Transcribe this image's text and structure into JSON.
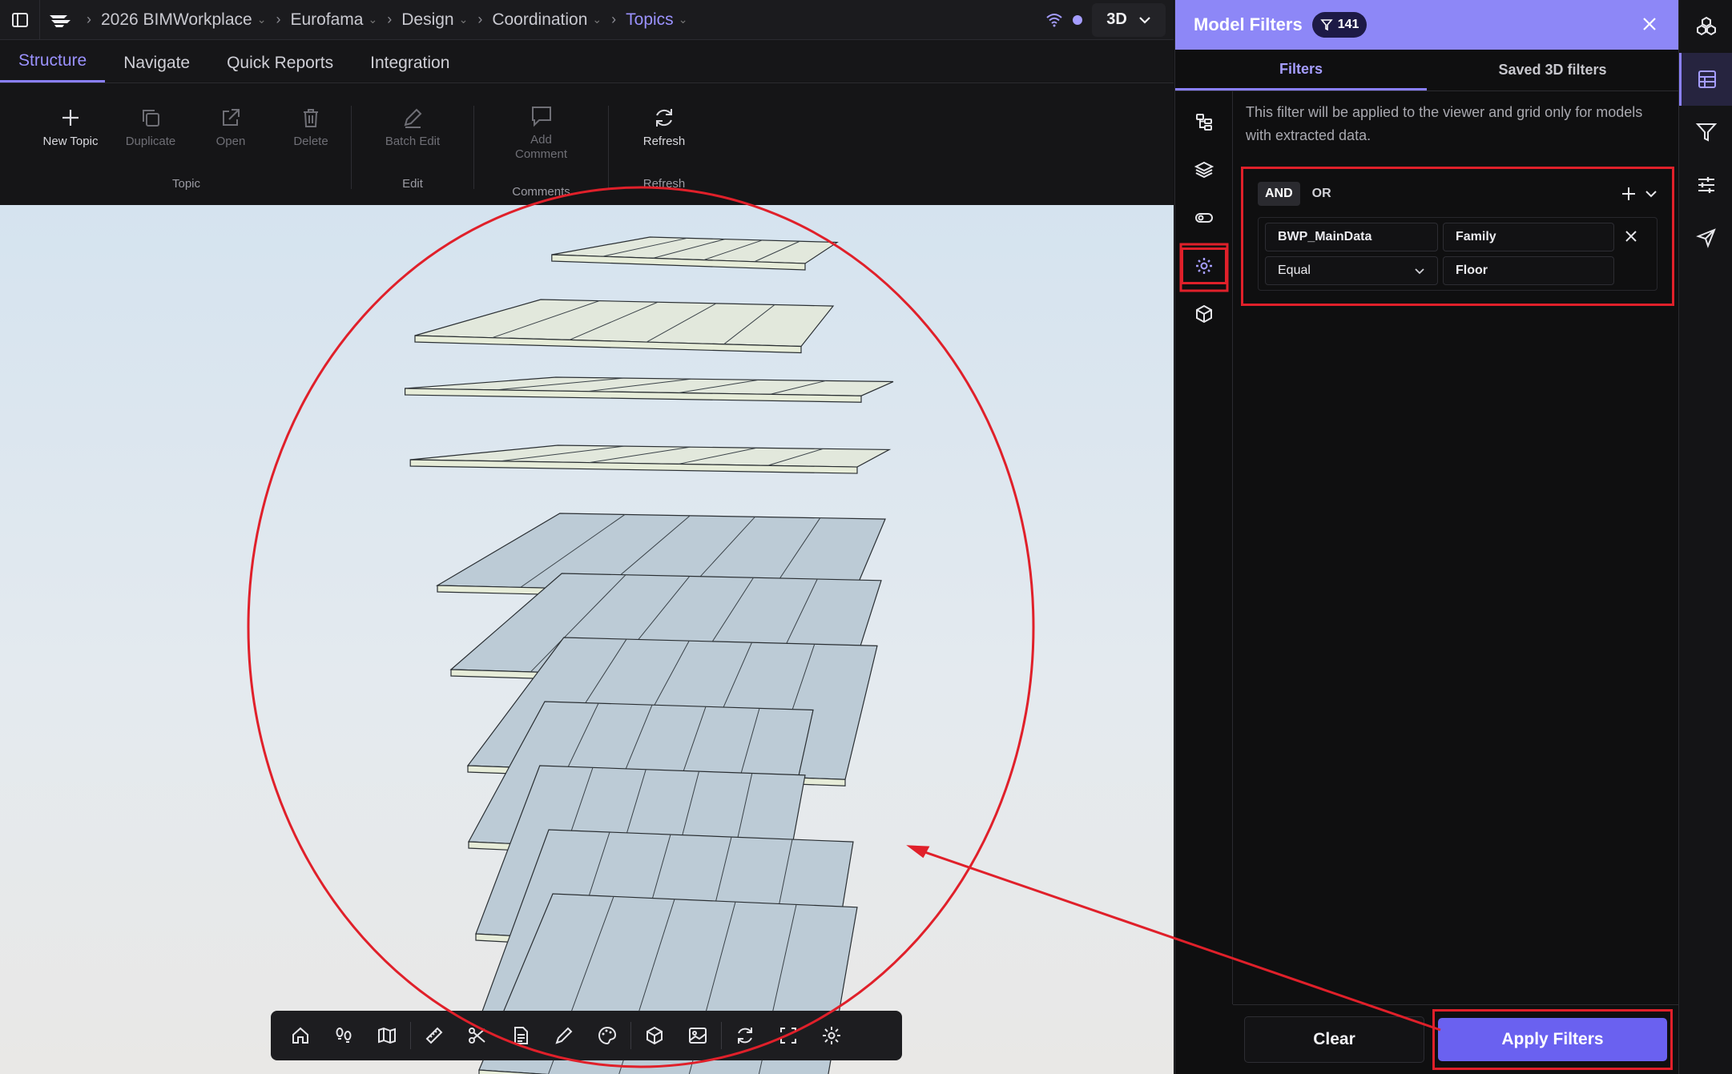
{
  "breadcrumb": {
    "items": [
      {
        "label": "2026 BIMWorkplace"
      },
      {
        "label": "Eurofama"
      },
      {
        "label": "Design"
      },
      {
        "label": "Coordination"
      },
      {
        "label": "Topics"
      }
    ]
  },
  "view_mode": {
    "label": "3D"
  },
  "tabs": [
    {
      "label": "Structure"
    },
    {
      "label": "Navigate"
    },
    {
      "label": "Quick Reports"
    },
    {
      "label": "Integration"
    }
  ],
  "ribbon": {
    "topic": {
      "group": "Topic",
      "new": "New Topic",
      "duplicate": "Duplicate",
      "open": "Open",
      "delete": "Delete"
    },
    "edit": {
      "group": "Edit",
      "batch": "Batch Edit"
    },
    "comments": {
      "group": "Comments",
      "add_line1": "Add",
      "add_line2": "Comment"
    },
    "refresh": {
      "group": "Refresh",
      "btn": "Refresh"
    }
  },
  "panel": {
    "title": "Model Filters",
    "badge_count": "141",
    "tabs": {
      "filters": "Filters",
      "saved": "Saved 3D filters"
    },
    "description": "This filter will be applied to the viewer and grid only for models with extracted data.",
    "logic": {
      "and": "AND",
      "or": "OR"
    },
    "rule": {
      "parameter_group": "BWP_MainData",
      "parameter": "Family",
      "operator": "Equal",
      "value": "Floor"
    },
    "clear": "Clear",
    "apply": "Apply Filters"
  },
  "colors": {
    "accent": "#8a80ff",
    "header": "#8d87f7",
    "apply": "#6a61f0",
    "annotation": "#e0202a"
  }
}
